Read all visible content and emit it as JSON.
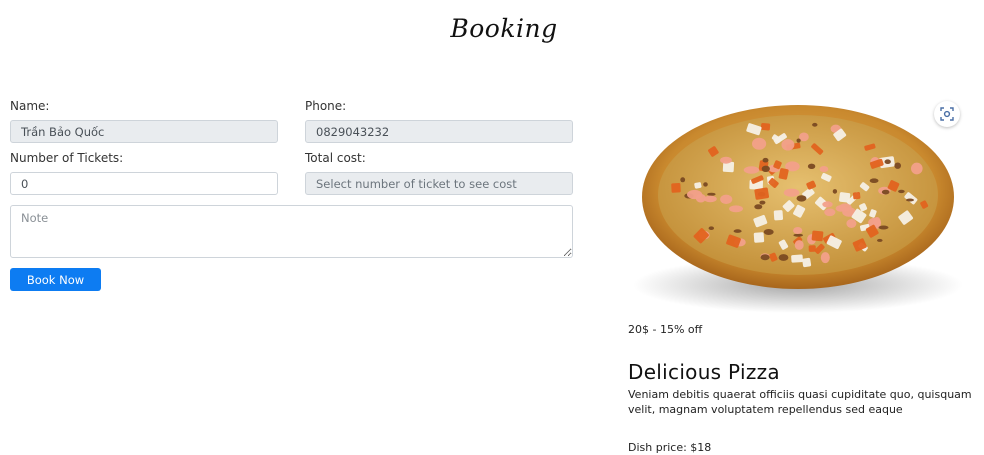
{
  "page": {
    "title": "Booking"
  },
  "form": {
    "name_label": "Name:",
    "name_value": "Trần Bảo Quốc",
    "phone_label": "Phone:",
    "phone_value": "0829043232",
    "tickets_label": "Number of Tickets:",
    "tickets_value": "0",
    "total_label": "Total cost:",
    "total_placeholder": "Select number of ticket to see cost",
    "note_placeholder": "Note",
    "submit_label": "Book Now"
  },
  "dish": {
    "image_icon": "pizza-image",
    "lens_icon": "visual-search-icon",
    "price_off": "20$ - 15% off",
    "title": "Delicious Pizza",
    "description": "Veniam debitis quaerat officiis quasi cupiditate quo, quisquam velit, magnam voluptatem repellendus sed eaque",
    "price": "Dish price: $18"
  },
  "colors": {
    "primary_button": "#0d7cf2",
    "readonly_field": "#e9ecef"
  }
}
